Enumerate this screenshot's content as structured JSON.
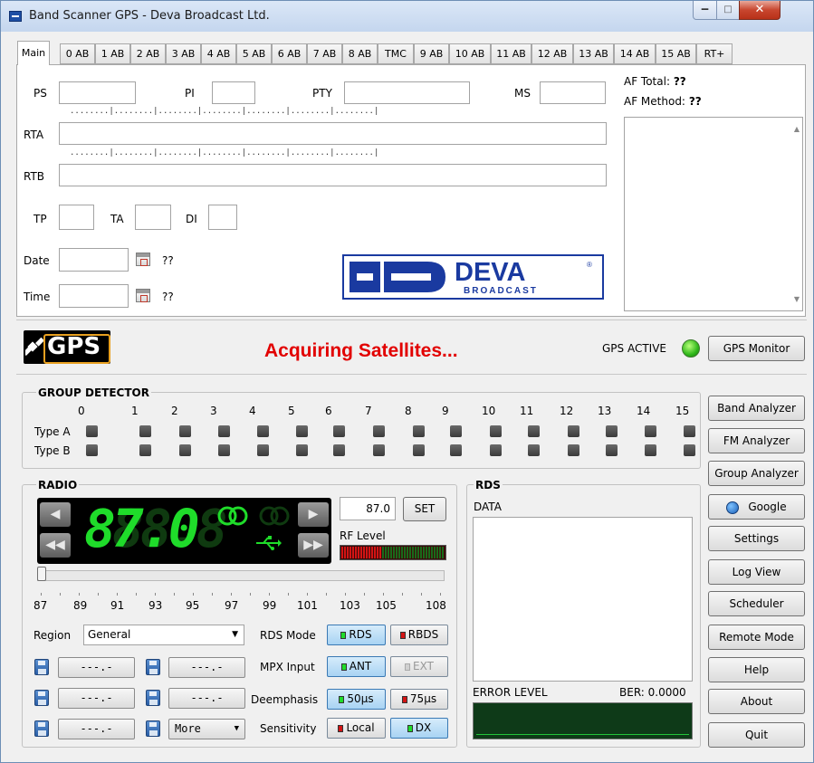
{
  "window": {
    "title": "Band Scanner GPS - Deva Broadcast Ltd.",
    "min": "‒",
    "max": "□",
    "close": "✕"
  },
  "tabs": [
    "Main",
    "0 AB",
    "1 AB",
    "2 AB",
    "3 AB",
    "4 AB",
    "5 AB",
    "6 AB",
    "7 AB",
    "8 AB",
    "TMC",
    "9 AB",
    "10 AB",
    "11 AB",
    "12 AB",
    "13 AB",
    "14 AB",
    "15 AB",
    "RT+"
  ],
  "main": {
    "ps_label": "PS",
    "pi_label": "PI",
    "pty_label": "PTY",
    "ms_label": "MS",
    "rta_label": "RTA",
    "rtb_label": "RTB",
    "tp_label": "TP",
    "ta_label": "TA",
    "di_label": "DI",
    "date_label": "Date",
    "time_label": "Time",
    "date_value": "??",
    "time_value": "??",
    "dots": "........|........|........|........|........|........|........|",
    "af_total_label": "AF Total:",
    "af_total_value": "??",
    "af_method_label": "AF Method:",
    "af_method_value": "??",
    "scroll_up": "▲",
    "scroll_down": "▼"
  },
  "logo": {
    "name": "DEVA",
    "sub": "BROADCAST",
    "reg": "®"
  },
  "gps": {
    "logo_text": "GPS",
    "status": "Acquiring Satellites...",
    "active_label": "GPS ACTIVE",
    "monitor_button": "GPS Monitor"
  },
  "group_detector": {
    "title": "GROUP DETECTOR",
    "columns": [
      "0",
      "1",
      "2",
      "3",
      "4",
      "5",
      "6",
      "7",
      "8",
      "9",
      "10",
      "11",
      "12",
      "13",
      "14",
      "15"
    ],
    "row_a": "Type A",
    "row_b": "Type B"
  },
  "radio": {
    "title": "RADIO",
    "display_freq": "87.0",
    "freq_input": "87.0",
    "set_button": "SET",
    "rf_level_label": "RF Level",
    "scale": [
      "87",
      "89",
      "91",
      "93",
      "95",
      "97",
      "99",
      "101",
      "103",
      "105",
      "108"
    ],
    "region_label": "Region",
    "region_value": "General",
    "rds_mode_label": "RDS Mode",
    "rds_btn": "RDS",
    "rbds_btn": "RBDS",
    "mpx_label": "MPX Input",
    "ant_btn": "ANT",
    "ext_btn": "EXT",
    "deemph_label": "Deemphasis",
    "d50_btn": "50µs",
    "d75_btn": "75µs",
    "sens_label": "Sensitivity",
    "local_btn": "Local",
    "dx_btn": "DX",
    "mem_empty": "---.-",
    "more": "More",
    "caret": "▼",
    "prev": "◀",
    "next": "▶",
    "rew": "◀◀",
    "ffw": "▶▶"
  },
  "rds": {
    "title": "RDS",
    "data_label": "DATA",
    "error_label": "ERROR LEVEL",
    "ber": "BER: 0.0000"
  },
  "side_buttons": [
    "Band Analyzer",
    "FM Analyzer",
    "Group Analyzer",
    "Google",
    "Settings",
    "Log View",
    "Scheduler",
    "Remote Mode",
    "Help",
    "About",
    "Quit"
  ],
  "colors": {
    "status_red": "#e20000",
    "digit_green": "#1fdc2a",
    "logo_blue": "#1a3aa0"
  }
}
